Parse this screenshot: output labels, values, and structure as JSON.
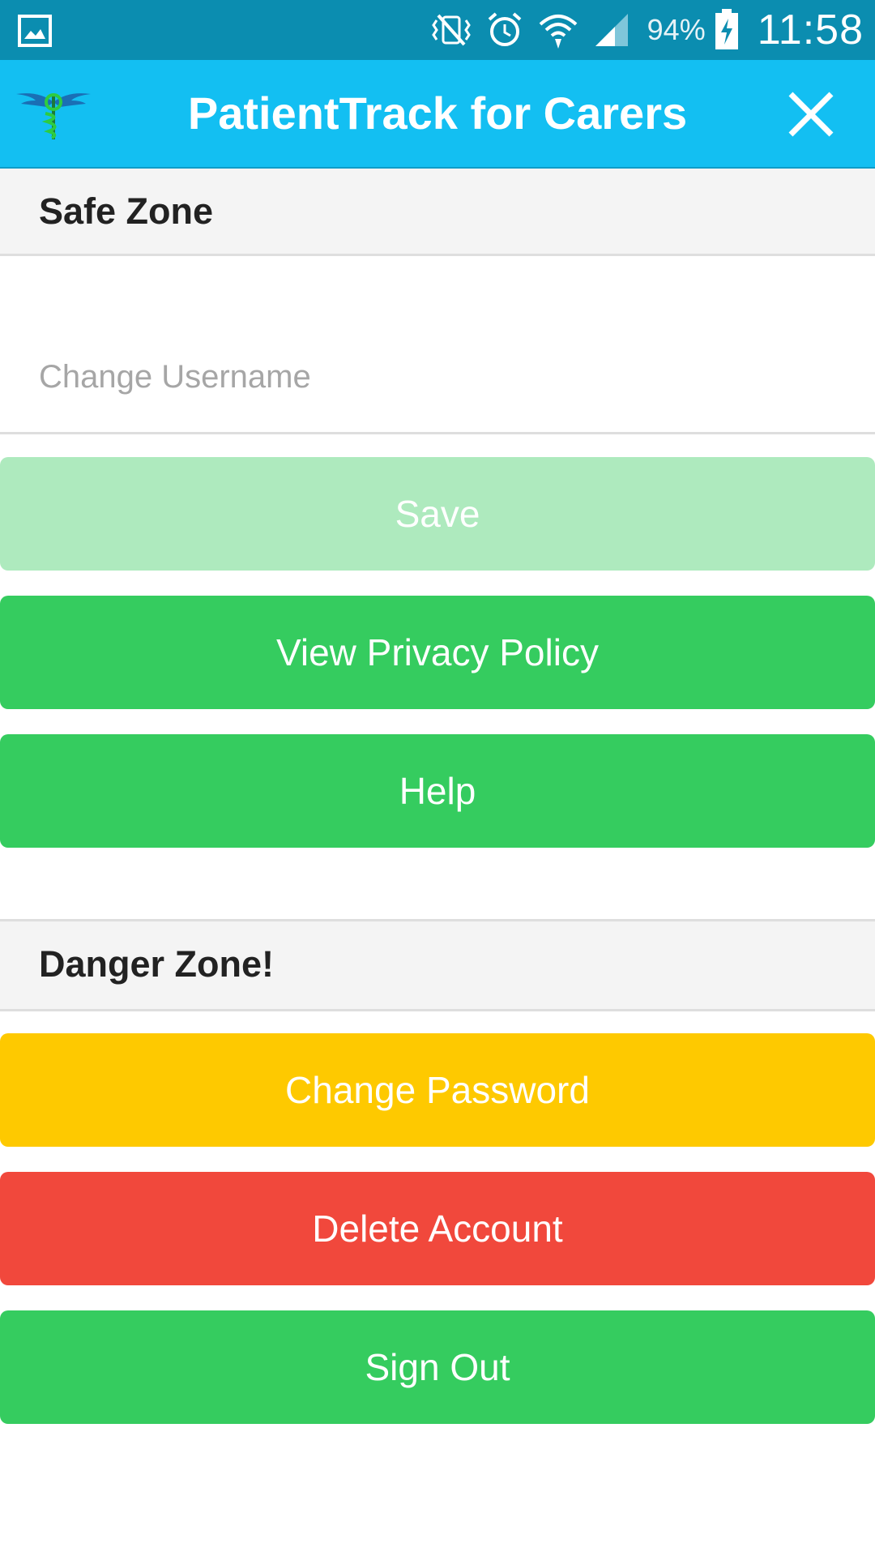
{
  "status_bar": {
    "battery_percent": "94%",
    "time": "11:58",
    "icons": [
      "gallery-icon",
      "vibrate-mute-icon",
      "alarm-icon",
      "wifi-icon",
      "signal-icon",
      "battery-charging-icon"
    ]
  },
  "header": {
    "title": "PatientTrack for Carers",
    "logo": "caduceus-logo",
    "close_icon": "close-icon"
  },
  "safe_zone": {
    "title": "Safe Zone",
    "username_input": {
      "value": "",
      "placeholder": "Change Username"
    },
    "save_label": "Save",
    "privacy_label": "View Privacy Policy",
    "help_label": "Help"
  },
  "danger_zone": {
    "title": "Danger Zone!",
    "change_password_label": "Change Password",
    "delete_account_label": "Delete Account",
    "sign_out_label": "Sign Out"
  },
  "colors": {
    "status_bar": "#0b8db0",
    "app_bar": "#13bff2",
    "green": "#35cc5f",
    "green_disabled": "#aeeabe",
    "yellow": "#fec900",
    "red": "#f1483c",
    "section_bg": "#f4f4f4"
  }
}
